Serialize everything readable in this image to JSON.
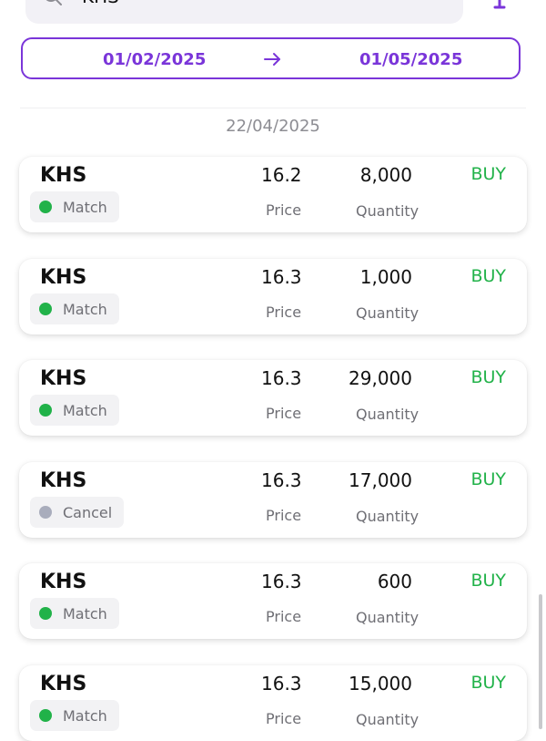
{
  "search": {
    "value": "KHS"
  },
  "date_range": {
    "from": "01/02/2025",
    "to": "01/05/2025"
  },
  "group_date": "22/04/2025",
  "labels": {
    "price": "Price",
    "quantity": "Quantity"
  },
  "colors": {
    "accent": "#7a35d9",
    "buy": "#21b249",
    "match_dot": "#21b249",
    "cancel_dot": "#a9adbc"
  },
  "orders": [
    {
      "symbol": "KHS",
      "price": "16.2",
      "quantity": "8,000",
      "side": "BUY",
      "status": "Match"
    },
    {
      "symbol": "KHS",
      "price": "16.3",
      "quantity": "1,000",
      "side": "BUY",
      "status": "Match"
    },
    {
      "symbol": "KHS",
      "price": "16.3",
      "quantity": "29,000",
      "side": "BUY",
      "status": "Match"
    },
    {
      "symbol": "KHS",
      "price": "16.3",
      "quantity": "17,000",
      "side": "BUY",
      "status": "Cancel"
    },
    {
      "symbol": "KHS",
      "price": "16.3",
      "quantity": "600",
      "side": "BUY",
      "status": "Match"
    },
    {
      "symbol": "KHS",
      "price": "16.3",
      "quantity": "15,000",
      "side": "BUY",
      "status": "Match"
    }
  ]
}
